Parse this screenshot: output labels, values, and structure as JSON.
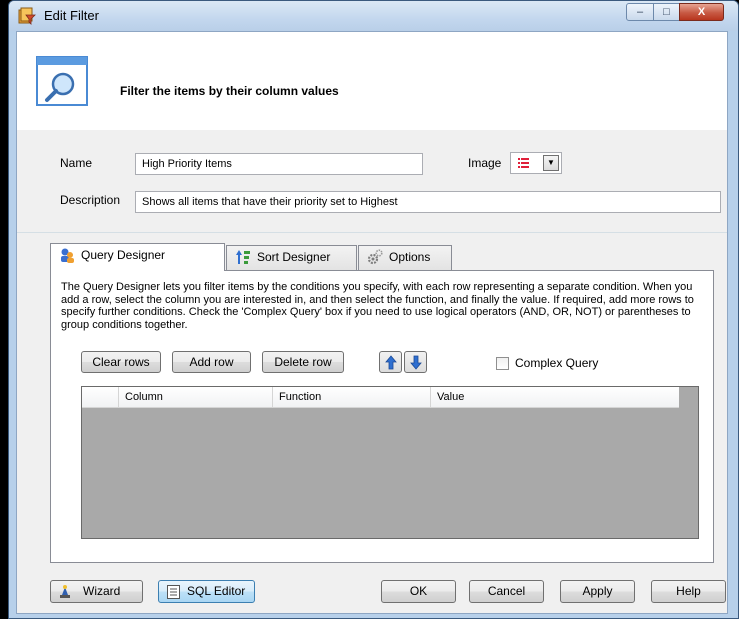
{
  "window": {
    "title": "Edit Filter",
    "controls": {
      "minimize": "‒",
      "maximize": "□",
      "close": "X"
    }
  },
  "header": {
    "text": "Filter the items by their column values"
  },
  "form": {
    "name_label": "Name",
    "name_value": "High Priority Items",
    "image_label": "Image",
    "description_label": "Description",
    "description_value": "Shows all items that have their priority set to Highest"
  },
  "tabs": [
    {
      "label": "Query Designer",
      "active": true
    },
    {
      "label": "Sort Designer",
      "active": false
    },
    {
      "label": "Options",
      "active": false
    }
  ],
  "query_designer": {
    "description": "The Query Designer lets you filter items by the conditions you specify, with each row representing a separate condition.  When you add a row, select the column you are interested in, and then select the function, and finally the value.  If required, add more rows to specify further conditions.  Check the 'Complex Query' box if you need to use logical operators (AND, OR, NOT) or parentheses to group conditions together.",
    "buttons": {
      "clear_rows": "Clear rows",
      "add_row": "Add row",
      "delete_row": "Delete row"
    },
    "complex_query_label": "Complex Query",
    "complex_query_checked": false,
    "grid_columns": [
      "",
      "Column",
      "Function",
      "Value"
    ],
    "grid_rows": []
  },
  "footer": {
    "wizard": "Wizard",
    "sql_editor": "SQL Editor",
    "ok": "OK",
    "cancel": "Cancel",
    "apply": "Apply",
    "help": "Help"
  },
  "colors": {
    "accent_blue": "#3c7fd4",
    "grid_bg": "#a9a9a9",
    "priority_red": "#e0203a"
  }
}
